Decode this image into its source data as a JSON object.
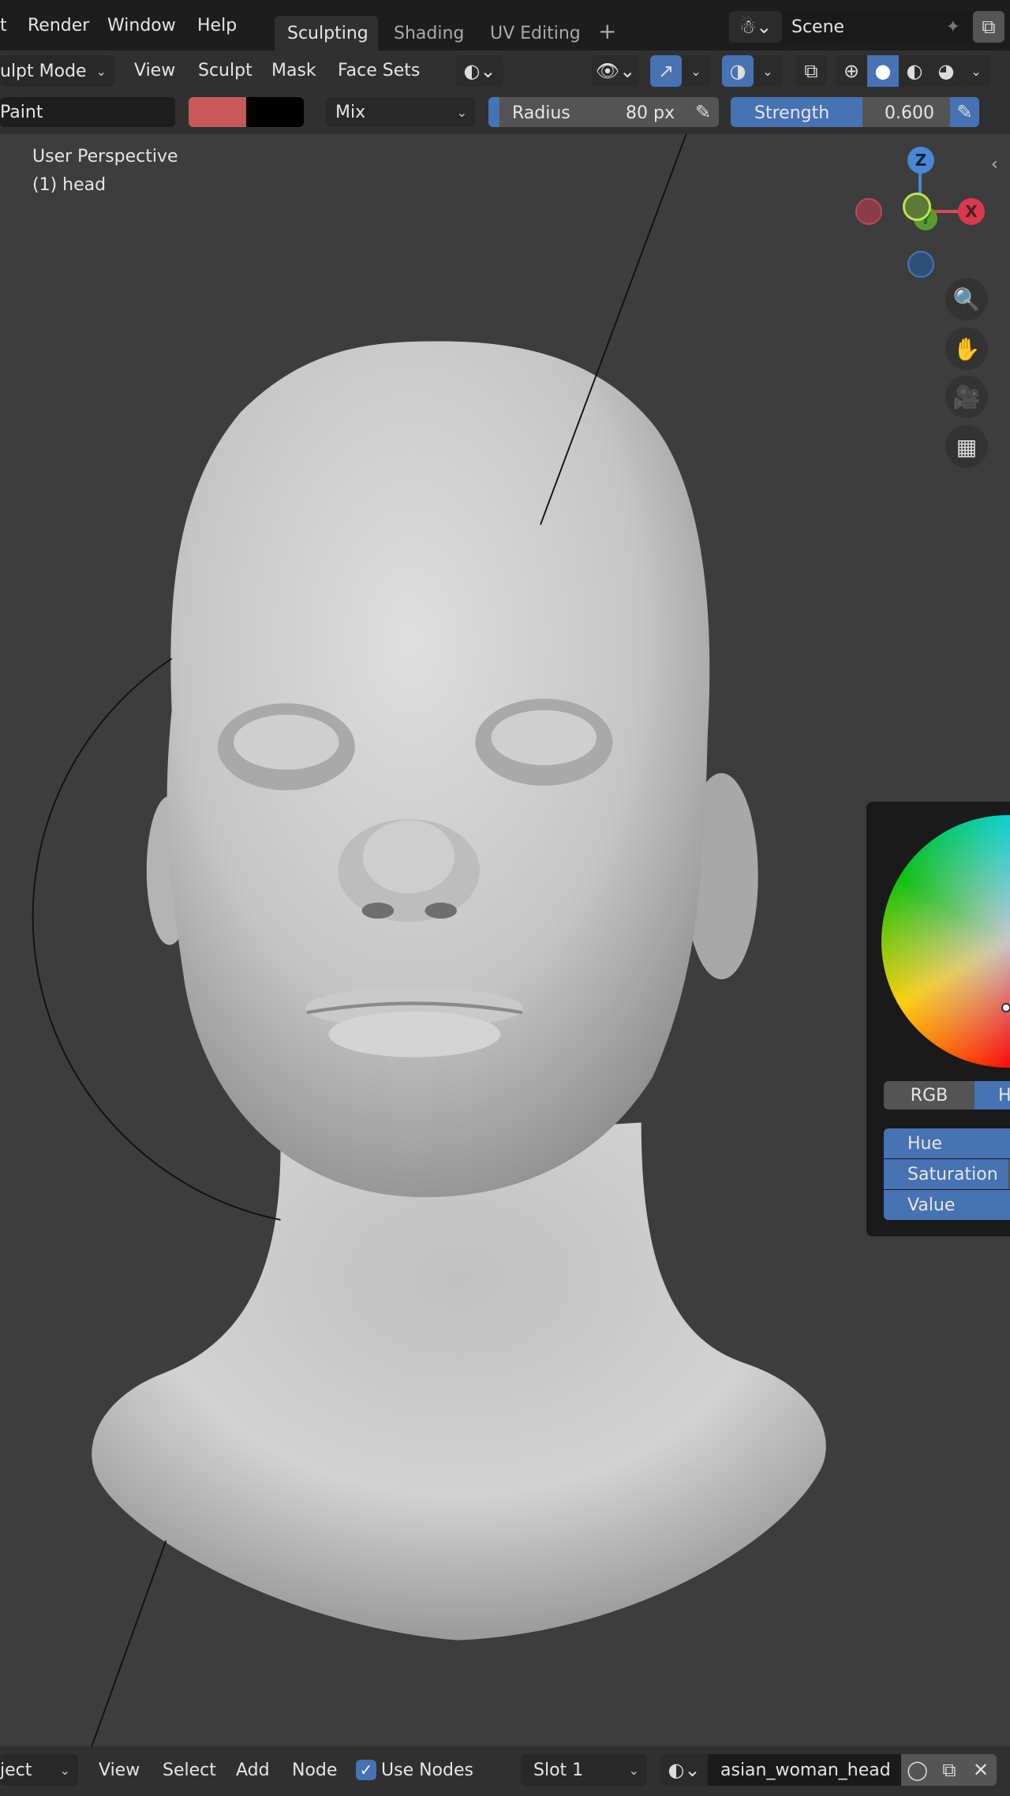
{
  "topbar": {
    "menu": [
      "t",
      "Render",
      "Window",
      "Help"
    ],
    "tabs": [
      "Sculpting",
      "Shading",
      "UV Editing"
    ],
    "add_tab": "+",
    "scene": "Scene"
  },
  "header": {
    "mode": "ulpt Mode",
    "menu": [
      "View",
      "Sculpt",
      "Mask",
      "Face Sets"
    ]
  },
  "tool": {
    "brush": "Paint",
    "color_primary": "#c8595a",
    "color_secondary": "#000000",
    "blend": "Mix",
    "radius_label": "Radius",
    "radius_value": "80 px",
    "strength_label": "Strength",
    "strength_value": "0.600",
    "strength_fraction": 0.6
  },
  "viewport": {
    "view_name": "User Perspective",
    "object": "(1) head",
    "gizmo": {
      "z": "Z",
      "x": "X",
      "y": "Y"
    }
  },
  "color_picker": {
    "mode_tabs": [
      "RGB",
      "H"
    ],
    "fields": [
      "Hue",
      "Saturation",
      "Value"
    ],
    "accent": "#4772b3"
  },
  "footer": {
    "mode": "ject",
    "menu": [
      "View",
      "Select",
      "Add",
      "Node"
    ],
    "use_nodes_label": "Use Nodes",
    "use_nodes": true,
    "slot": "Slot 1",
    "material": "asian_woman_head"
  }
}
